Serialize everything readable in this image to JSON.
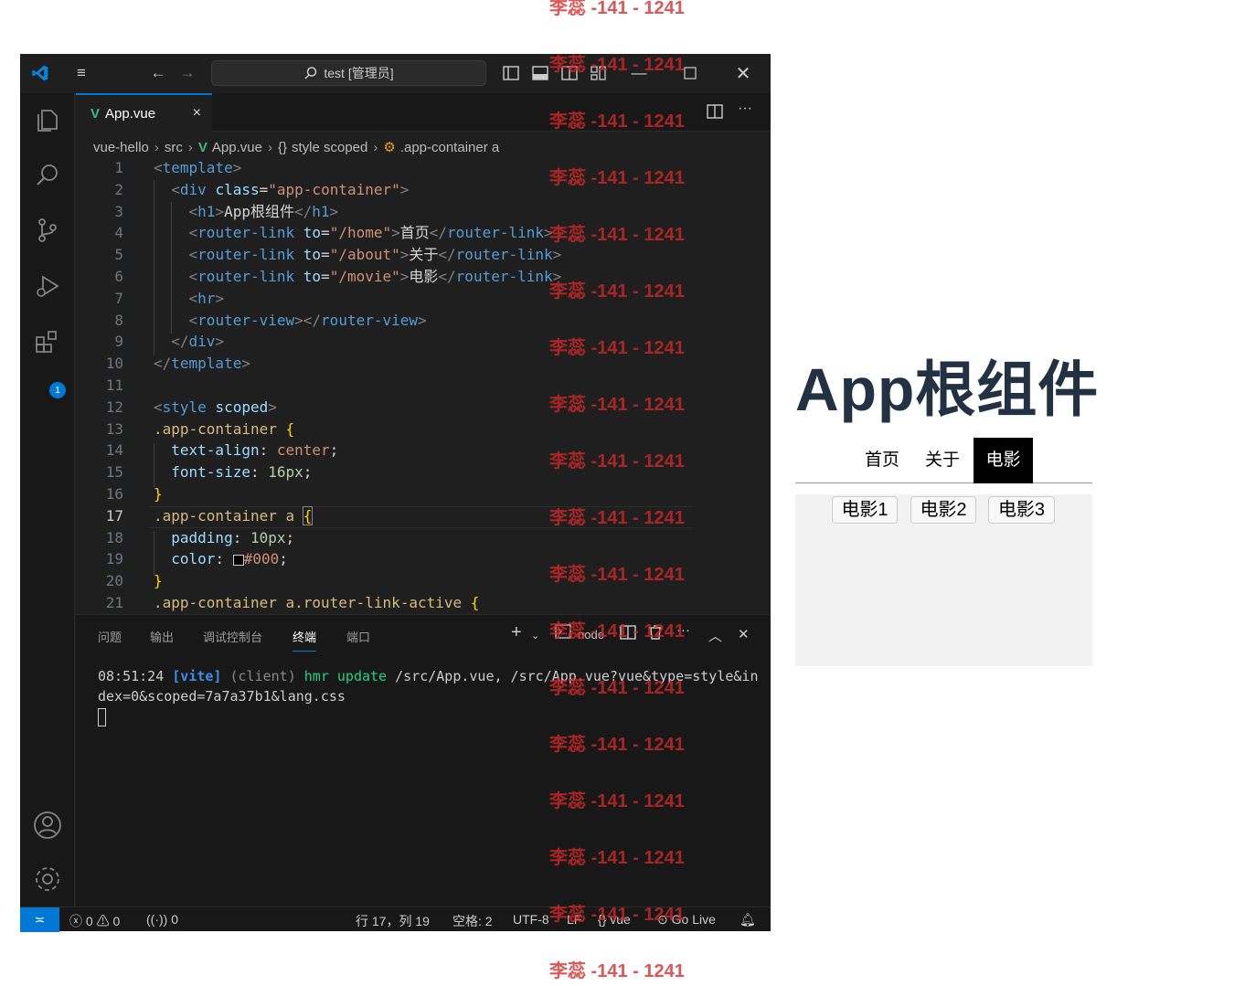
{
  "window": {
    "search_text": "test [管理员]"
  },
  "activity_badge": "1",
  "tab": {
    "label": "App.vue",
    "close": "×"
  },
  "breadcrumb": [
    "vue-hello",
    "src",
    "App.vue",
    "style scoped",
    ".app-container a"
  ],
  "code_lines": [
    {
      "n": "1",
      "html": "<span class='t'>&lt;</span><span class='tag'>template</span><span class='t'>&gt;</span>"
    },
    {
      "n": "2",
      "html": "  <span class='t'>&lt;</span><span class='tag'>div</span> <span class='attr'>class</span><span class='txt'>=</span><span class='str'>\"app-container\"</span><span class='t'>&gt;</span>"
    },
    {
      "n": "3",
      "html": "    <span class='t'>&lt;</span><span class='tag'>h1</span><span class='t'>&gt;</span><span class='txt'>App根组件</span><span class='t'>&lt;/</span><span class='tag'>h1</span><span class='t'>&gt;</span>"
    },
    {
      "n": "4",
      "html": "    <span class='t'>&lt;</span><span class='tag'>router-link</span> <span class='attr'>to</span><span class='txt'>=</span><span class='str'>\"/home\"</span><span class='t'>&gt;</span><span class='txt'>首页</span><span class='t'>&lt;/</span><span class='tag'>router-link</span><span class='t'>&gt;</span>"
    },
    {
      "n": "5",
      "html": "    <span class='t'>&lt;</span><span class='tag'>router-link</span> <span class='attr'>to</span><span class='txt'>=</span><span class='str'>\"/about\"</span><span class='t'>&gt;</span><span class='txt'>关于</span><span class='t'>&lt;/</span><span class='tag'>router-link</span><span class='t'>&gt;</span>"
    },
    {
      "n": "6",
      "html": "    <span class='t'>&lt;</span><span class='tag'>router-link</span> <span class='attr'>to</span><span class='txt'>=</span><span class='str'>\"/movie\"</span><span class='t'>&gt;</span><span class='txt'>电影</span><span class='t'>&lt;/</span><span class='tag'>router-link</span><span class='t'>&gt;</span>"
    },
    {
      "n": "7",
      "html": "    <span class='t'>&lt;</span><span class='tag'>hr</span><span class='t'>&gt;</span>"
    },
    {
      "n": "8",
      "html": "    <span class='t'>&lt;</span><span class='tag'>router-view</span><span class='t'>&gt;&lt;/</span><span class='tag'>router-view</span><span class='t'>&gt;</span>"
    },
    {
      "n": "9",
      "html": "  <span class='t'>&lt;/</span><span class='tag'>div</span><span class='t'>&gt;</span>"
    },
    {
      "n": "10",
      "html": "<span class='t'>&lt;/</span><span class='tag'>template</span><span class='t'>&gt;</span>"
    },
    {
      "n": "11",
      "html": ""
    },
    {
      "n": "12",
      "html": "<span class='t'>&lt;</span><span class='tag'>style</span> <span class='attr'>scoped</span><span class='t'>&gt;</span>"
    },
    {
      "n": "13",
      "html": "<span class='sel'>.app-container</span> <span class='br'>{</span>"
    },
    {
      "n": "14",
      "html": "  <span class='prop'>text-align</span><span class='txt'>: </span><span class='val'>center</span><span class='txt'>;</span>"
    },
    {
      "n": "15",
      "html": "  <span class='prop'>font-size</span><span class='txt'>: </span><span class='num'>16px</span><span class='txt'>;</span>"
    },
    {
      "n": "16",
      "html": "<span class='br'>}</span>"
    },
    {
      "n": "17",
      "html": "<span class='sel'>.app-container a</span> <span class='br' style='outline:1px solid #888'>{</span>"
    },
    {
      "n": "18",
      "html": "  <span class='prop'>padding</span><span class='txt'>: </span><span class='num'>10px</span><span class='txt'>;</span>"
    },
    {
      "n": "19",
      "html": "  <span class='prop'>color</span><span class='txt'>: </span><span style='display:inline-block;width:12px;height:12px;border:1px solid #ccc;background:#000;vertical-align:middle'></span><span class='val'>#000</span><span class='txt'>;</span>"
    },
    {
      "n": "20",
      "html": "<span class='br'>}</span>"
    },
    {
      "n": "21",
      "html": "<span class='sel'>.app-container a.router-link-active</span> <span class='br'>{</span>"
    }
  ],
  "panel_tabs": [
    "问题",
    "输出",
    "调试控制台",
    "终端",
    "端口"
  ],
  "panel_terminal_name": "node",
  "terminal": {
    "time": "08:51:24",
    "tag": "[vite]",
    "client": "(client)",
    "event": "hmr update",
    "path1": "/src/App.vue, /src/App.vue?vue&type=style&in",
    "path2": "dex=0&scoped=7a7a37b1&lang.css"
  },
  "status": {
    "errors": "0",
    "warnings": "0",
    "ports": "0",
    "position": "行 17，列 19",
    "spaces": "空格: 2",
    "encoding": "UTF-8",
    "eol": "LF",
    "language": "vue",
    "golive": "Go Live"
  },
  "watermark": "李蕊 -141 - 1241",
  "preview": {
    "title": "App根组件",
    "nav": [
      "首页",
      "关于",
      "电影"
    ],
    "active_nav": "电影",
    "movies": [
      "电影1",
      "电影2",
      "电影3"
    ]
  }
}
